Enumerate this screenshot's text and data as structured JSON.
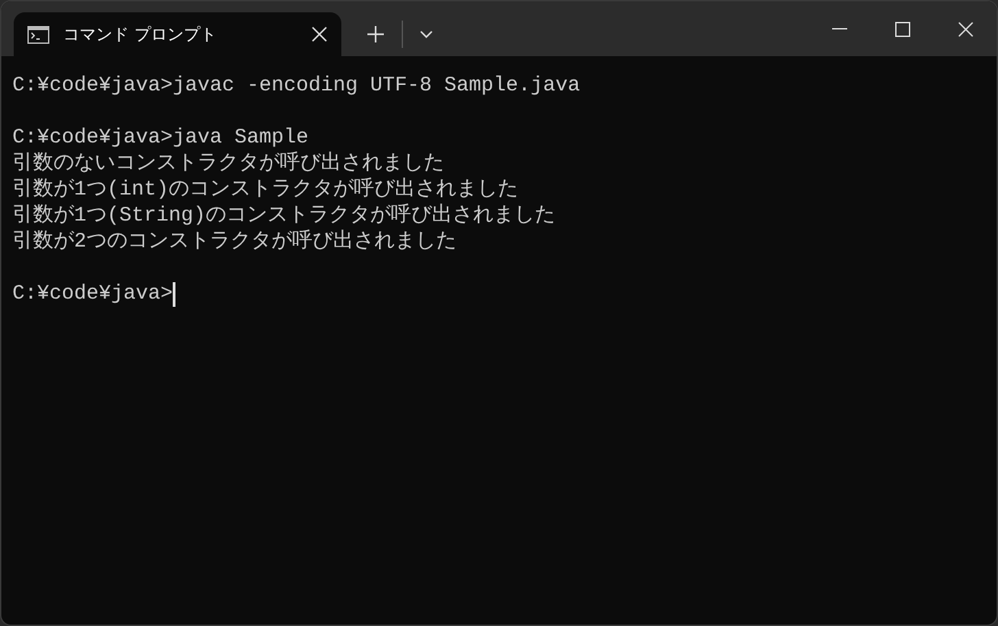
{
  "tabs": [
    {
      "title": "コマンド プロンプト",
      "selected": true
    }
  ],
  "console": {
    "blocks": [
      [
        "C:¥code¥java>javac -encoding UTF-8 Sample.java"
      ],
      [
        "C:¥code¥java>java Sample",
        "引数のないコンストラクタが呼び出されました",
        "引数が1つ(int)のコンストラクタが呼び出されました",
        "引数が1つ(String)のコンストラクタが呼び出されました",
        "引数が2つのコンストラクタが呼び出されました"
      ]
    ],
    "prompt": {
      "text": "C:¥code¥java>",
      "cursor": true
    }
  }
}
